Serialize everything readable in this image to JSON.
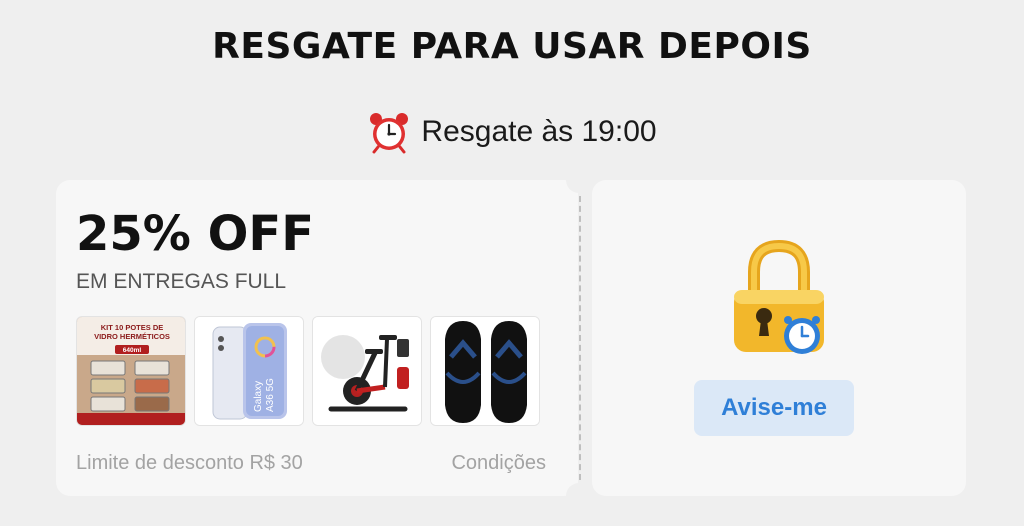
{
  "header": {
    "title": "RESGATE PARA USAR DEPOIS",
    "timer_text": "Resgate às 19:00",
    "timer_icon": "alarm-clock-icon"
  },
  "coupon": {
    "discount": "25% OFF",
    "subtitle": "EM ENTREGAS FULL",
    "limit": "Limite de desconto R$ 30",
    "conditions": "Condições",
    "products": [
      {
        "name": "kit-potes-vidro",
        "banner": "KIT 10 POTES DE VIDRO HERMÉTICOS",
        "size": "640ml"
      },
      {
        "name": "galaxy-phone",
        "label": "Galaxy A36 5G"
      },
      {
        "name": "spinning-bike"
      },
      {
        "name": "flip-flops"
      }
    ],
    "lock_icon": "padlock-clock-icon",
    "notify_label": "Avise-me",
    "accent_color": "#2f7fd7"
  }
}
